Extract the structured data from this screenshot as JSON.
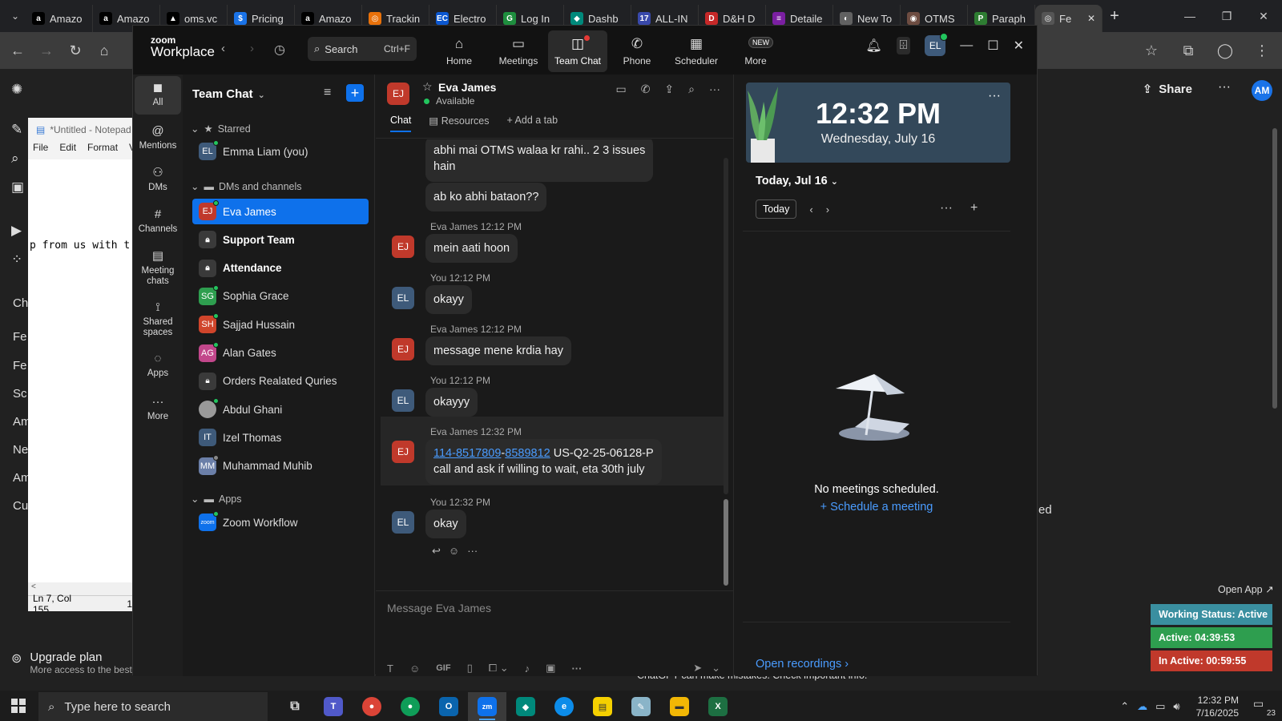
{
  "browser": {
    "tabs": [
      {
        "label": "Amazo",
        "icon": "amazon-icon",
        "color": "#000000",
        "glyph": "a"
      },
      {
        "label": "Amazo",
        "icon": "amazon-icon",
        "color": "#000000",
        "glyph": "a"
      },
      {
        "label": "oms.vc",
        "icon": "oms-icon",
        "color": "#000000",
        "glyph": "▲"
      },
      {
        "label": "Pricing",
        "icon": "pricing-icon",
        "color": "#1a73e8",
        "glyph": "$"
      },
      {
        "label": "Amazo",
        "icon": "amazon-icon",
        "color": "#000000",
        "glyph": "a"
      },
      {
        "label": "Trackin",
        "icon": "tracking-icon",
        "color": "#e8710a",
        "glyph": "◎"
      },
      {
        "label": "Electro",
        "icon": "electro-icon",
        "color": "#0b57d0",
        "glyph": "EC"
      },
      {
        "label": "Log In",
        "icon": "login-icon",
        "color": "#1e8e3e",
        "glyph": "G"
      },
      {
        "label": "Dashb",
        "icon": "dashboard-icon",
        "color": "#00897b",
        "glyph": "◆"
      },
      {
        "label": "ALL-IN",
        "icon": "allin-icon",
        "color": "#3949ab",
        "glyph": "17"
      },
      {
        "label": "D&H D",
        "icon": "dh-icon",
        "color": "#c62828",
        "glyph": "D"
      },
      {
        "label": "Detaile",
        "icon": "detailed-icon",
        "color": "#7b1fa2",
        "glyph": "≡"
      },
      {
        "label": "New To",
        "icon": "newtab-icon",
        "color": "#616161",
        "glyph": "◐"
      },
      {
        "label": "OTMS",
        "icon": "otms-icon",
        "color": "#6d4c41",
        "glyph": "◉"
      },
      {
        "label": "Paraph",
        "icon": "paraphrase-icon",
        "color": "#2e7d32",
        "glyph": "P"
      },
      {
        "label": "Fe",
        "icon": "chatgpt-icon",
        "color": "#555555",
        "glyph": "◎",
        "active": true
      }
    ]
  },
  "gpt": {
    "left_items": [
      "Ch",
      "Fe",
      "Fe",
      "Sc",
      "Am",
      "Ne",
      "Am",
      "Cu"
    ],
    "upgrade_title": "Upgrade plan",
    "upgrade_sub": "More access to the best models",
    "share_label": "Share",
    "avatar": "AM",
    "footer": "ChatGPT can make mistakes. Check important info.",
    "partial_text": "ed"
  },
  "notepad": {
    "title": "*Untitled - Notepad",
    "menu": [
      "File",
      "Edit",
      "Format",
      "V"
    ],
    "line": "p from us with t",
    "status": "Ln 7, Col 155",
    "status2": "1"
  },
  "zoom": {
    "logo_small": "zoom",
    "logo_big": "Workplace",
    "search_label": "Search",
    "search_shortcut": "Ctrl+F",
    "nav": [
      {
        "label": "Home",
        "icon": "home-icon",
        "glyph": "⌂"
      },
      {
        "label": "Meetings",
        "icon": "video-camera-icon",
        "glyph": "▭"
      },
      {
        "label": "Team Chat",
        "icon": "chat-icon",
        "glyph": "◫",
        "active": true
      },
      {
        "label": "Phone",
        "icon": "phone-icon",
        "glyph": "✆"
      },
      {
        "label": "Scheduler",
        "icon": "scheduler-icon",
        "glyph": "▦"
      },
      {
        "label": "More",
        "icon": "more-icon",
        "glyph": "⋯",
        "badge": "NEW"
      }
    ],
    "avatar": "EL",
    "rail": [
      {
        "label": "All",
        "icon": "chat-bubble-icon",
        "glyph": "◼",
        "active": true
      },
      {
        "label": "Mentions",
        "icon": "at-icon",
        "glyph": "@"
      },
      {
        "label": "DMs",
        "icon": "people-icon",
        "glyph": "⚇"
      },
      {
        "label": "Channels",
        "icon": "hash-icon",
        "glyph": "#"
      },
      {
        "label": "Meeting chats",
        "icon": "meeting-chat-icon",
        "glyph": "▤"
      },
      {
        "label": "Shared spaces",
        "icon": "shared-spaces-icon",
        "glyph": "⟟"
      },
      {
        "label": "Apps",
        "icon": "apps-icon",
        "glyph": "◌"
      },
      {
        "label": "More",
        "icon": "more-icon",
        "glyph": "···"
      }
    ],
    "list": {
      "title": "Team Chat",
      "starred_label": "Starred",
      "dms_label": "DMs and channels",
      "apps_label": "Apps",
      "starred": [
        {
          "initials": "EL",
          "name": "Emma Liam (you)",
          "color": "#3e5a7a",
          "status": "online"
        }
      ],
      "dms": [
        {
          "initials": "EJ",
          "name": "Eva James",
          "color": "#c0392b",
          "status": "online",
          "selected": true
        },
        {
          "initials": "",
          "name": "Support Team",
          "color": "#3a3a3a",
          "lock": true,
          "bold": true
        },
        {
          "initials": "",
          "name": "Attendance",
          "color": "#3a3a3a",
          "lock": true,
          "bold": true
        },
        {
          "initials": "SG",
          "name": "Sophia Grace",
          "color": "#2e9e4f",
          "status": "online"
        },
        {
          "initials": "SH",
          "name": "Sajjad Hussain",
          "color": "#d0452b",
          "status": "online"
        },
        {
          "initials": "AG",
          "name": "Alan Gates",
          "color": "#c2478b",
          "status": "online"
        },
        {
          "initials": "",
          "name": "Orders Realated Quries",
          "color": "#3a3a3a",
          "lock": true
        },
        {
          "initials": "",
          "name": "Abdul Ghani",
          "color": "#777777",
          "status": "online",
          "photo": true
        },
        {
          "initials": "IT",
          "name": "Izel Thomas",
          "color": "#3e5a7a"
        },
        {
          "initials": "MM",
          "name": "Muhammad Muhib",
          "color": "#6b7fa8",
          "status": "away"
        }
      ],
      "apps": [
        {
          "initials": "zoom",
          "name": "Zoom Workflow",
          "color": "#0e71eb",
          "status": "online"
        }
      ]
    },
    "chat": {
      "contact_initials": "EJ",
      "contact_name": "Eva James",
      "contact_status": "Available",
      "tabs": [
        "Chat",
        "Resources",
        "Add a tab"
      ],
      "messages": [
        {
          "who": "EJ",
          "continued": true,
          "lines": [
            "abhi mai OTMS walaa kr rahi.. 2 3 issues",
            "hain"
          ]
        },
        {
          "who": "EJ",
          "continued": true,
          "lines": [
            "ab ko abhi bataon??"
          ]
        },
        {
          "who": "EJ",
          "meta": "Eva James 12:12 PM",
          "lines": [
            "mein aati hoon"
          ]
        },
        {
          "who": "EL",
          "meta": "You 12:12 PM",
          "lines": [
            "okayy"
          ]
        },
        {
          "who": "EJ",
          "meta": "Eva James 12:12 PM",
          "lines": [
            "message mene krdia hay"
          ]
        },
        {
          "who": "EL",
          "meta": "You 12:12 PM",
          "lines": [
            "okayyy"
          ]
        },
        {
          "who": "EJ",
          "meta": "Eva James 12:32 PM",
          "link1": "114-8517809",
          "dash": "-",
          "link2": "8589812",
          "tail": " US-Q2-25-06128-P",
          "line2": "call and ask if willing to wait, eta 30th july"
        },
        {
          "who": "EL",
          "meta": "You 12:32 PM",
          "lines": [
            "okay"
          ]
        }
      ],
      "composer_placeholder": "Message Eva James"
    },
    "calendar": {
      "time": "12:32 PM",
      "date": "Wednesday, July 16",
      "day_label": "Today, Jul 16",
      "today_btn": "Today",
      "empty": "No meetings scheduled.",
      "schedule": "Schedule a meeting",
      "open_recordings": "Open recordings"
    }
  },
  "status_widget": {
    "open_app": "Open App ↗",
    "working": "Working Status: Active",
    "active": "Active: 04:39:53",
    "inactive": "In Active: 00:59:55",
    "colors": {
      "working": "#3a8fa0",
      "active": "#2e9e4f",
      "inactive": "#c0392b"
    }
  },
  "taskbar": {
    "search_placeholder": "Type here to search",
    "time": "12:32 PM",
    "date": "7/16/2025",
    "notifications": "23"
  }
}
